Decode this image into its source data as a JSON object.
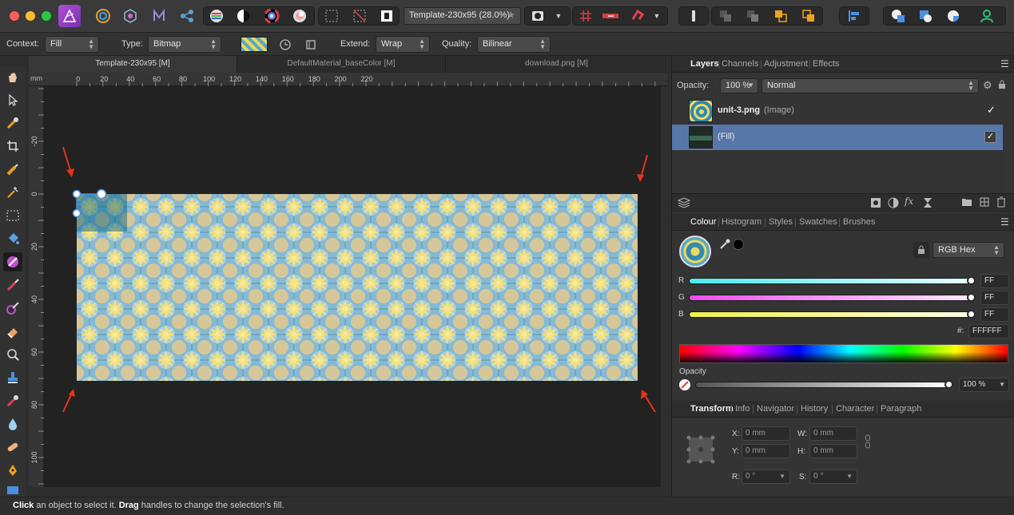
{
  "toolbar": {
    "doc_selector": "Template-230x95 (28.0%)"
  },
  "context_bar": {
    "context_label": "Context:",
    "context_value": "Fill",
    "type_label": "Type:",
    "type_value": "Bitmap",
    "extend_label": "Extend:",
    "extend_value": "Wrap",
    "quality_label": "Quality:",
    "quality_value": "Bilinear"
  },
  "doc_tabs": [
    {
      "label": "Template-230x95 [M]"
    },
    {
      "label": "DefaultMaterial_baseColor [M]"
    },
    {
      "label": "download.png [M]"
    }
  ],
  "ruler": {
    "unit": "mm",
    "h_ticks": [
      "0",
      "20",
      "40",
      "60",
      "80",
      "100",
      "120",
      "140",
      "160",
      "180",
      "200",
      "220"
    ],
    "v_ticks": [
      "-20",
      "0",
      "20",
      "40",
      "60",
      "80",
      "100"
    ]
  },
  "layers_panel": {
    "tabs": [
      "Layers",
      "Channels",
      "Adjustment",
      "Effects"
    ],
    "opacity_label": "Opacity:",
    "opacity_value": "100 %",
    "blend_mode": "Normal",
    "layers": [
      {
        "name": "unit-3.png",
        "type": "(Image)",
        "checked": true
      },
      {
        "name": "(Fill)",
        "type": "",
        "checked": true
      }
    ]
  },
  "colour_panel": {
    "tabs": [
      "Colour",
      "Histogram",
      "Styles",
      "Swatches",
      "Brushes"
    ],
    "model": "RGB Hex",
    "channels": [
      {
        "label": "R",
        "value": "FF",
        "color": "#4ee9f0"
      },
      {
        "label": "G",
        "value": "FF",
        "color": "#f04cf0"
      },
      {
        "label": "B",
        "value": "FF",
        "color": "#f0f04c"
      }
    ],
    "hex_label": "#:",
    "hex_value": "FFFFFF",
    "opacity_label": "Opacity",
    "opacity_value": "100 %"
  },
  "transform_panel": {
    "tabs": [
      "Transform",
      "Info",
      "Navigator",
      "History",
      "Character",
      "Paragraph"
    ],
    "x_label": "X:",
    "x_value": "0 mm",
    "y_label": "Y:",
    "y_value": "0 mm",
    "w_label": "W:",
    "w_value": "0 mm",
    "h_label": "H:",
    "h_value": "0 mm",
    "r_label": "R:",
    "r_value": "0 °",
    "s_label": "S:",
    "s_value": "0 °"
  },
  "status": {
    "click": "Click",
    "click_rest": " an object to select it. ",
    "drag": "Drag",
    "drag_rest": " handles to change the selection's fill."
  },
  "colors": {
    "accent": "#5677a8",
    "pattern_blue": "#7fb3cf",
    "pattern_yellow": "#f3e27a",
    "annotation_red": "#e8331c"
  }
}
